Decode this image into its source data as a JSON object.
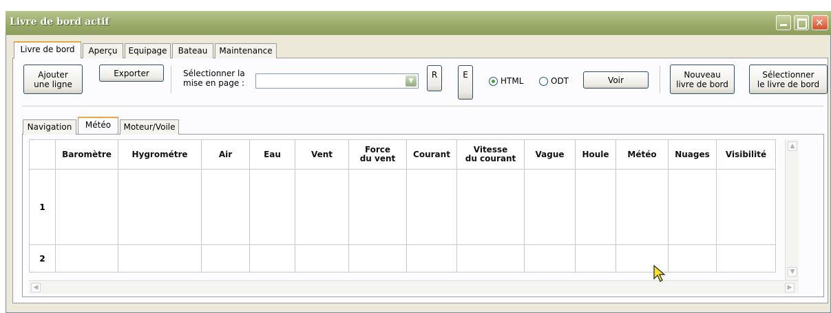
{
  "window": {
    "title": "Livre de bord actif",
    "minimize_label": "_",
    "maximize_label": "□",
    "close_label": "✕"
  },
  "main_tabs": [
    {
      "label": "Livre de bord",
      "active": true
    },
    {
      "label": "Aperçu",
      "active": false
    },
    {
      "label": "Equipage",
      "active": false
    },
    {
      "label": "Bateau",
      "active": false
    },
    {
      "label": "Maintenance",
      "active": false
    }
  ],
  "toolbar": {
    "add_line": "Ajouter\nune ligne",
    "export": "Exporter",
    "layout_label": "Sélectionner la\nmise en page :",
    "layout_value": "",
    "btn_r": "R",
    "btn_e": "E",
    "radio_html": "HTML",
    "radio_odt": "ODT",
    "format_selected": "HTML",
    "view": "Voir",
    "new_logbook": "Nouveau\nlivre de bord",
    "select_logbook": "Sélectionner\nle livre de bord"
  },
  "sub_tabs": [
    {
      "label": "Navigation",
      "active": false
    },
    {
      "label": "Météo",
      "active": true
    },
    {
      "label": "Moteur/Voile",
      "active": false
    }
  ],
  "grid": {
    "columns": [
      "Baromètre",
      "Hygrométre",
      "Air",
      "Eau",
      "Vent",
      "Force\ndu vent",
      "Courant",
      "Vitesse\ndu courant",
      "Vague",
      "Houle",
      "Météo",
      "Nuages",
      "Visibilité"
    ],
    "rows": [
      {
        "num": "1",
        "cells": [
          "",
          "",
          "",
          "",
          "",
          "",
          "",
          "",
          "",
          "",
          "",
          "",
          ""
        ]
      },
      {
        "num": "2",
        "cells": [
          "",
          "",
          "",
          "",
          "",
          "",
          "",
          "",
          "",
          "",
          "",
          "",
          ""
        ]
      }
    ]
  },
  "icons": {
    "combo_arrow": "dropdown-arrow-icon",
    "scroll_up": "scroll-up-icon",
    "scroll_down": "scroll-down-icon",
    "scroll_left": "scroll-left-icon",
    "scroll_right": "scroll-right-icon",
    "cursor": "mouse-cursor-icon"
  },
  "colors": {
    "titlebar": "#98aa68",
    "window_bg": "#ece9d8",
    "active_tab_accent": "#e8a840",
    "radio_dot": "#3aa53a"
  }
}
